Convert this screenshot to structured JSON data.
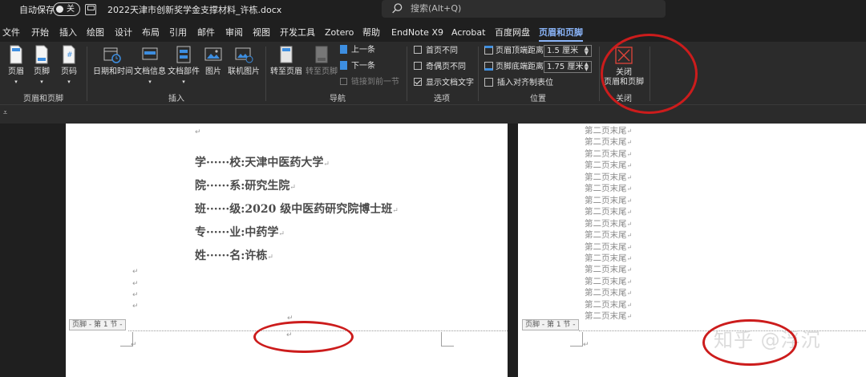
{
  "titlebar": {
    "autosave_label": "自动保存",
    "autosave_state": "关",
    "document_title": "2022天津市创新奖学金支撑材料_许栋.docx",
    "search_placeholder": "搜索(Alt+Q)"
  },
  "menu": {
    "items": [
      "文件",
      "开始",
      "插入",
      "绘图",
      "设计",
      "布局",
      "引用",
      "邮件",
      "审阅",
      "视图",
      "开发工具",
      "Zotero",
      "帮助",
      "EndNote X9",
      "Acrobat",
      "百度网盘",
      "页眉和页脚"
    ],
    "active": "页眉和页脚"
  },
  "ribbon": {
    "group_header_footer": {
      "label": "页眉和页脚",
      "header": "页眉",
      "footer": "页脚",
      "page_number": "页码"
    },
    "group_insert": {
      "label": "插入",
      "date_time": "日期和时间",
      "doc_info": "文档信息",
      "doc_parts": "文档部件",
      "picture": "图片",
      "online_picture": "联机图片"
    },
    "group_navigation": {
      "label": "导航",
      "goto_header": "转至页眉",
      "goto_footer": "转至页脚",
      "previous": "上一条",
      "next": "下一条",
      "link_to_previous": "链接到前一节"
    },
    "group_options": {
      "label": "选项",
      "different_first_page": "首页不同",
      "different_odd_even": "奇偶页不同",
      "show_document_text": "显示文档文字",
      "different_first_page_checked": false,
      "different_odd_even_checked": false,
      "show_document_text_checked": true
    },
    "group_position": {
      "label": "位置",
      "header_from_top": "页眉顶端距离:",
      "header_from_top_value": "1.5 厘米",
      "footer_from_bottom": "页脚底端距离:",
      "footer_from_bottom_value": "1.75 厘米",
      "insert_alignment_tab": "插入对齐制表位"
    },
    "group_close": {
      "label": "关闭",
      "close_line1": "关闭",
      "close_line2": "页眉和页脚"
    }
  },
  "document": {
    "page1_lines": [
      "学······校:天津中医药大学",
      "院······系:研究生院",
      "班······级:2020 级中医药研究院博士班",
      "专······业:中药学",
      "姓······名:许栋"
    ],
    "paragraph_mark": "↵",
    "footer_tag": "页脚 - 第 1 节 -",
    "page2_repeated_line": "第二页末尾",
    "page2_line_count": 17
  },
  "watermark": "知乎 @浮沉",
  "colors": {
    "accent": "#8ab4f8",
    "annotation_red": "#cc1c1c",
    "close_icon_red": "#e0443a"
  }
}
